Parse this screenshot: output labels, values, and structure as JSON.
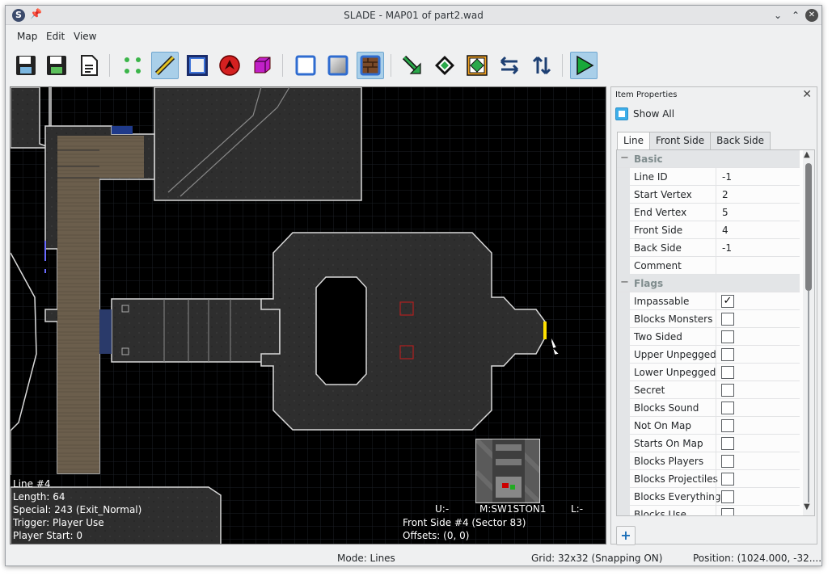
{
  "window": {
    "title": "SLADE - MAP01 of part2.wad"
  },
  "menu": [
    "Map",
    "Edit",
    "View"
  ],
  "toolbar": {
    "icons": [
      "save-icon",
      "save-all-icon",
      "save-as-icon",
      "vertices-mode-icon",
      "lines-mode-icon",
      "sectors-mode-icon",
      "things-mode-icon",
      "3d-mode-icon",
      "flat-mode-normal-icon",
      "flat-mode-textured-icon",
      "flat-mode-textured-full-icon",
      "map-checks-icon",
      "script-editor-icon",
      "map-properties-icon",
      "flip-horizontal-icon",
      "flip-vertical-icon",
      "run-map-icon"
    ],
    "accent": "#a9cfe9"
  },
  "canvas": {
    "line_info": [
      "Line #4",
      "Length: 64",
      "Special: 243 (Exit_Normal)",
      "Trigger: Player Use",
      "Player Start: 0"
    ],
    "side_info": [
      "Front Side #4 (Sector 83)",
      "Offsets: (0, 0)"
    ],
    "tex_upper": "U:-",
    "tex_middle": "M:SW1STON1",
    "tex_lower": "L:-",
    "highlight_color": "#ffe000"
  },
  "panel": {
    "title": "Item Properties",
    "show_all": "Show All",
    "tabs": [
      "Line",
      "Front Side",
      "Back Side"
    ],
    "basic_label": "Basic",
    "flags_label": "Flags",
    "props": [
      {
        "name": "Line ID",
        "value": "-1"
      },
      {
        "name": "Start Vertex",
        "value": "2"
      },
      {
        "name": "End Vertex",
        "value": "5"
      },
      {
        "name": "Front Side",
        "value": "4"
      },
      {
        "name": "Back Side",
        "value": "-1"
      },
      {
        "name": "Comment",
        "value": ""
      }
    ],
    "flags": [
      {
        "name": "Impassable",
        "checked": true
      },
      {
        "name": "Blocks Monsters",
        "checked": false
      },
      {
        "name": "Two Sided",
        "checked": false
      },
      {
        "name": "Upper Unpegged",
        "checked": false
      },
      {
        "name": "Lower Unpegged",
        "checked": false
      },
      {
        "name": "Secret",
        "checked": false
      },
      {
        "name": "Blocks Sound",
        "checked": false
      },
      {
        "name": "Not On Map",
        "checked": false
      },
      {
        "name": "Starts On Map",
        "checked": false
      },
      {
        "name": "Blocks Players",
        "checked": false
      },
      {
        "name": "Blocks Projectiles",
        "checked": false
      },
      {
        "name": "Blocks Everything",
        "checked": false
      },
      {
        "name": "Blocks Use",
        "checked": false
      }
    ],
    "check_mark": "✓",
    "add_label": "+"
  },
  "status": {
    "mode": "Mode: Lines",
    "grid": "Grid: 32x32 (Snapping ON)",
    "position": "Position: (1024.000, -32...."
  }
}
